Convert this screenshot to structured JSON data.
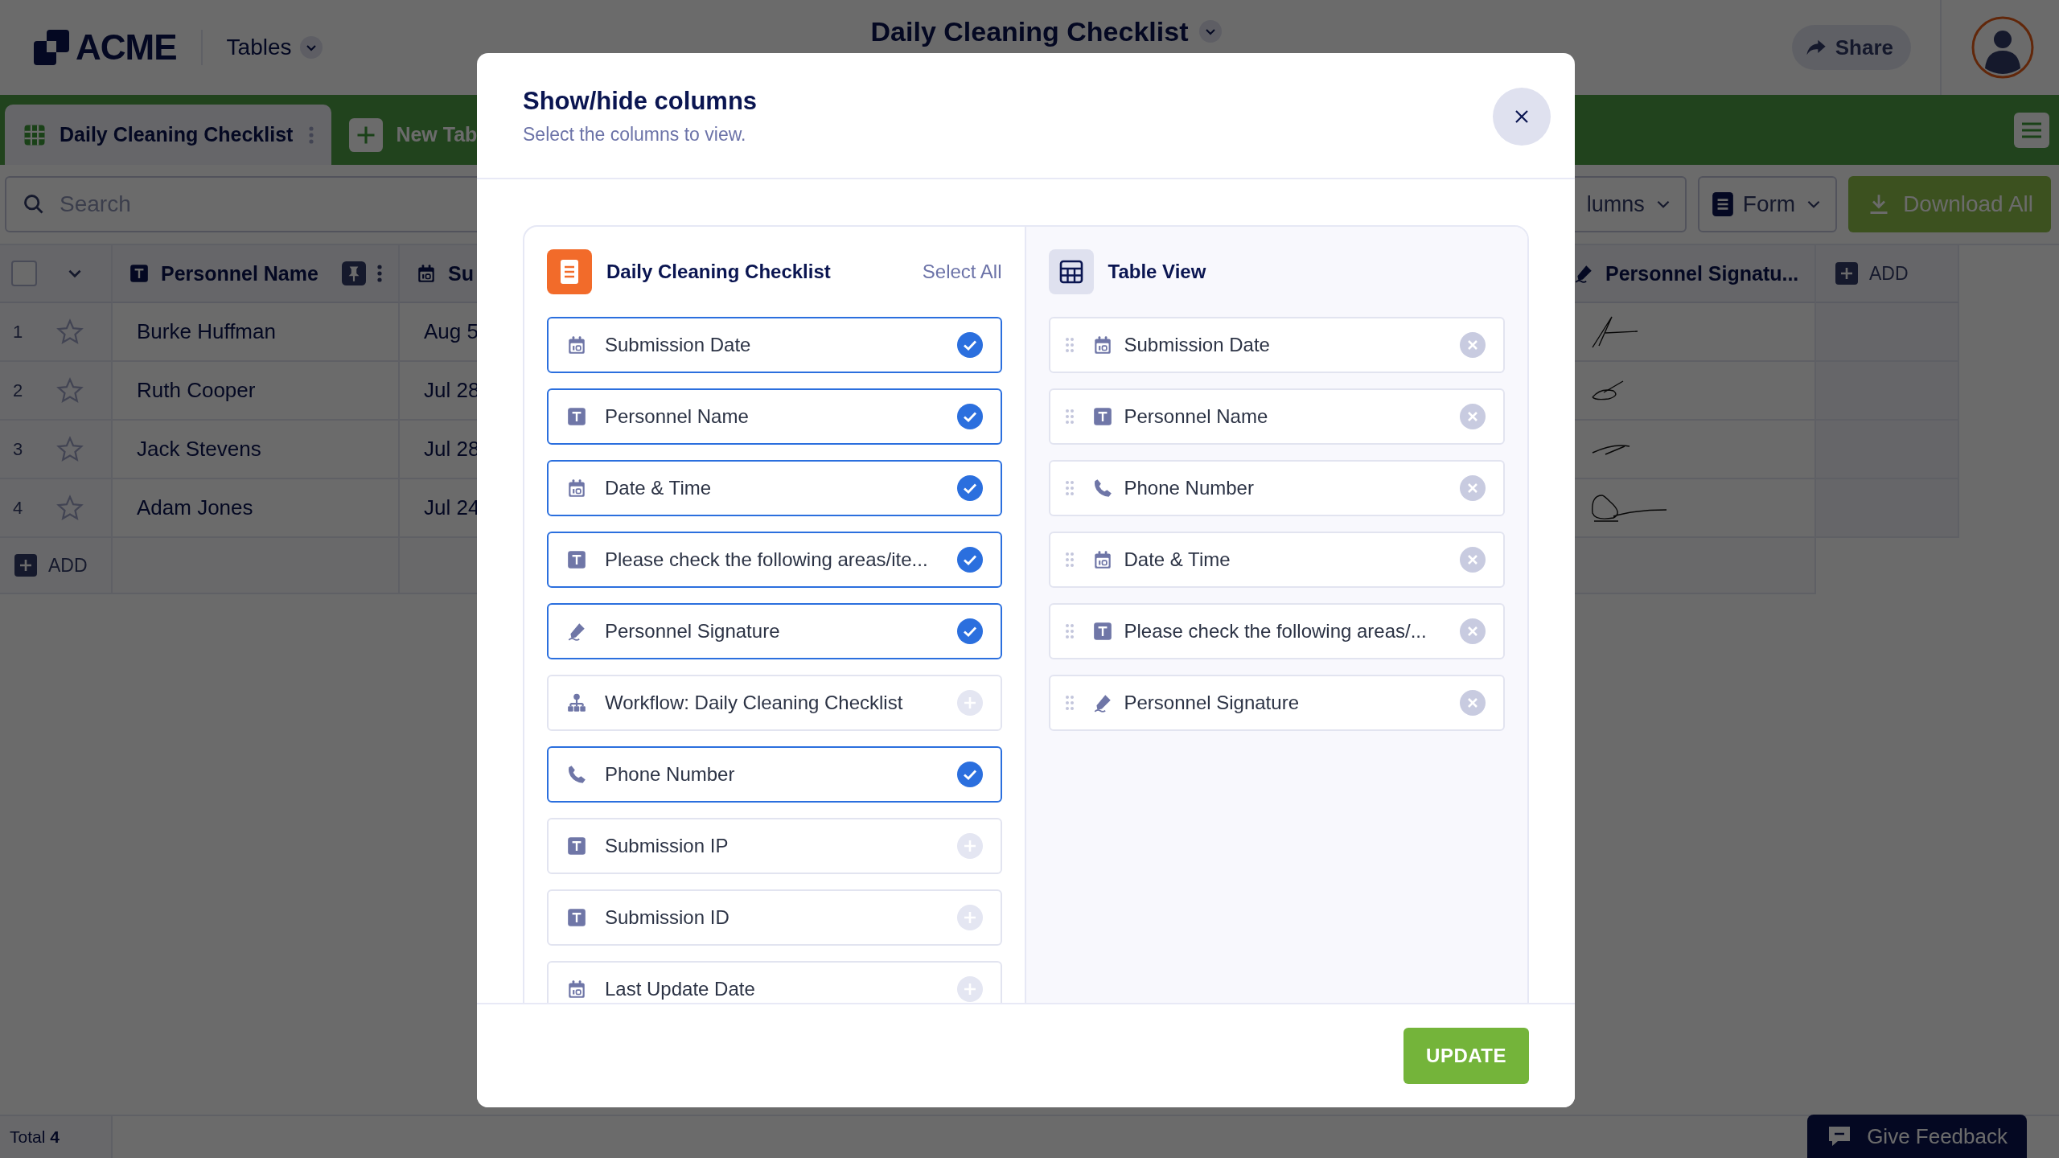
{
  "header": {
    "logo": "ACME",
    "menu": "Tables",
    "title": "Daily Cleaning Checklist",
    "share": "Share"
  },
  "tabs": [
    {
      "label": "Daily Cleaning Checklist",
      "selected": true,
      "kind": "table"
    },
    {
      "label": "New Tab",
      "selected": false,
      "kind": "add"
    }
  ],
  "toolbar": {
    "search_placeholder": "Search",
    "columns_button": "lumns",
    "form_button": "Form",
    "download_button": "Download All"
  },
  "table": {
    "columns": [
      {
        "label": "Personnel Name",
        "kind": "text",
        "pinned": true
      },
      {
        "label": "Su",
        "kind": "date",
        "pinned": false
      },
      {
        "label": "Personnel Signatu...",
        "kind": "signature",
        "pinned": false
      }
    ],
    "add_column": "ADD",
    "select_all_checked": false,
    "rows": [
      {
        "number": "1",
        "starred": false,
        "name": "Burke Huffman",
        "date": "Aug 5"
      },
      {
        "number": "2",
        "starred": false,
        "name": "Ruth Cooper",
        "date": "Jul 28"
      },
      {
        "number": "3",
        "starred": false,
        "name": "Jack Stevens",
        "date": "Jul 28"
      },
      {
        "number": "4",
        "starred": false,
        "name": "Adam Jones",
        "date": "Jul 24"
      }
    ],
    "add_row": "ADD"
  },
  "modal": {
    "title": "Show/hide columns",
    "subtitle": "Select the columns to view.",
    "source": {
      "title": "Daily Cleaning Checklist",
      "select_all": "Select All",
      "items": [
        {
          "label": "Submission Date",
          "kind": "date",
          "selected": true
        },
        {
          "label": "Personnel Name",
          "kind": "text",
          "selected": true
        },
        {
          "label": "Date & Time",
          "kind": "date",
          "selected": true
        },
        {
          "label": "Please check the following areas/ite...",
          "kind": "text",
          "selected": true
        },
        {
          "label": "Personnel Signature",
          "kind": "signature",
          "selected": true
        },
        {
          "label": "Workflow: Daily Cleaning Checklist",
          "kind": "workflow",
          "selected": false
        },
        {
          "label": "Phone Number",
          "kind": "phone",
          "selected": true
        },
        {
          "label": "Submission IP",
          "kind": "text",
          "selected": false
        },
        {
          "label": "Submission ID",
          "kind": "text",
          "selected": false
        },
        {
          "label": "Last Update Date",
          "kind": "date",
          "selected": false
        }
      ]
    },
    "view": {
      "title": "Table View",
      "items": [
        {
          "label": "Submission Date",
          "kind": "date"
        },
        {
          "label": "Personnel Name",
          "kind": "text"
        },
        {
          "label": "Phone Number",
          "kind": "phone"
        },
        {
          "label": "Date & Time",
          "kind": "date"
        },
        {
          "label": "Please check the following areas/...",
          "kind": "text"
        },
        {
          "label": "Personnel Signature",
          "kind": "signature"
        }
      ]
    },
    "update": "UPDATE"
  },
  "status_bar": {
    "total_label": "Total",
    "total": "4"
  },
  "feedback": "Give Feedback"
}
